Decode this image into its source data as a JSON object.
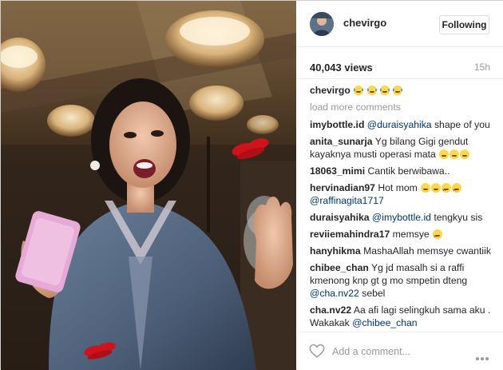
{
  "post": {
    "username": "chevirgo",
    "follow_label": "Following",
    "views": "40,043 views",
    "age": "15h",
    "caption_user": "chevirgo",
    "load_more": "load more comments"
  },
  "comments": [
    {
      "user": "imybottle.id",
      "mention": "@duraisyahika",
      "text": " shape of you"
    },
    {
      "user": "anita_sunarja",
      "text": "Yg bilang Gigi gendut kayaknya musti operasi mata"
    },
    {
      "user": "18063_mimi",
      "text": "Cantik berwibawa.."
    },
    {
      "user": "hervinadian97",
      "text": "Hot mom",
      "mention2": "@raffinagita1717"
    },
    {
      "user": "duraisyahika",
      "mention": "@imybottle.id",
      "text": " tengkyu sis"
    },
    {
      "user": "reviiemahindra17",
      "text": "memsye"
    },
    {
      "user": "hanyhikma",
      "text": "MashaAllah memsye cwantiik"
    },
    {
      "user": "chibee_chan",
      "text": "Yg jd masalh si a raffi kmenong knp gt g mo smpetin dteng",
      "mention2": "@cha.nv22",
      "text2": " sebel"
    },
    {
      "user": "cha.nv22",
      "text": "Aa afi lagi selingkuh sama aku . Wakakak",
      "mention2": "@chibee_chan"
    }
  ],
  "footer": {
    "placeholder": "Add a comment..."
  },
  "icons": {
    "like": "heart-outline-icon",
    "more": "ellipsis-icon",
    "emoji": "emoji-icon"
  },
  "colors": {
    "mention": "#003569",
    "muted": "#999999",
    "border": "#efefef"
  }
}
